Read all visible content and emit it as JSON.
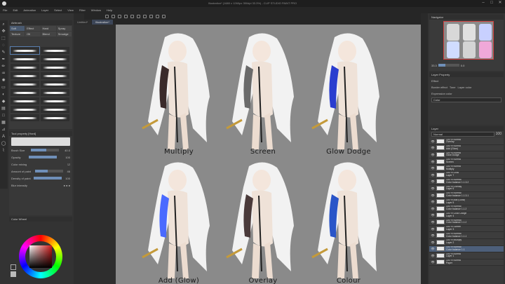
{
  "window": {
    "title": "Illustration* (1680 x 1260px 350dpi 33.3%) - CLIP STUDIO PAINT PRO",
    "controls": [
      "–",
      "□",
      "✕"
    ]
  },
  "menu": [
    "File",
    "Edit",
    "Animation",
    "Layer",
    "Select",
    "View",
    "Filter",
    "Window",
    "Help"
  ],
  "canvas_tabs": [
    "Untitled*",
    "Illustration*"
  ],
  "subtool": {
    "header": "Airbrush",
    "tabs": [
      "Soft",
      "Effect",
      "Hard",
      "Spray",
      "Texture",
      "Oil",
      "Blend",
      "Smudge"
    ]
  },
  "tool_property": {
    "header": "Tool property [Hard]",
    "brush_name": "Hard",
    "rows": [
      {
        "label": "Brush Size",
        "value": "40.0"
      },
      {
        "label": "Opacity",
        "value": "100"
      },
      {
        "label": "Color mixing",
        "value": ""
      },
      {
        "label": "Amount of paint",
        "value": "46"
      },
      {
        "label": "Density of paint",
        "value": "100"
      },
      {
        "label": "Blur intensity",
        "value": ""
      }
    ]
  },
  "color_panel": {
    "header": "Color Wheel"
  },
  "figures": [
    {
      "label": "Multiply",
      "accent": "#3a2a2a"
    },
    {
      "label": "Screen",
      "accent": "#6a6a6a"
    },
    {
      "label": "Glow Dodge",
      "accent": "#2a3dcf"
    },
    {
      "label": "Add (Glow)",
      "accent": "#4a6aff"
    },
    {
      "label": "Overlay",
      "accent": "#4a3a3a"
    },
    {
      "label": "Colour",
      "accent": "#2a55c8"
    }
  ],
  "navigator": {
    "header": "Navigator",
    "zoom": "33.3",
    "angle": "0.0"
  },
  "layer_property": {
    "header": "Layer Property",
    "effect_label": "Effect",
    "expression_label": "Expression color",
    "expression_value": "Color",
    "effect_buttons": [
      "Border effect",
      "Tone",
      "Layer color"
    ]
  },
  "layers": {
    "header": "Layer",
    "blend_mode": "Normal",
    "opacity": "100",
    "items": [
      {
        "name": "100 % Normal\nOverlay"
      },
      {
        "name": "100 % Normal\nAdd (Glow)"
      },
      {
        "name": "100 % Normal\nGlow Dodge"
      },
      {
        "name": "100 % Normal\nScreen"
      },
      {
        "name": "100 % Normal\nMultiply"
      },
      {
        "name": "100 % Glow\nLayer 7"
      },
      {
        "name": "100 % Normal\nColor balance 1.1.3.2"
      },
      {
        "name": "100 % Overlay\nLayer 6"
      },
      {
        "name": "100 % Normal\nColor balance 1.1.3.1"
      },
      {
        "name": "100 % Add (Glow)\nLayer 5"
      },
      {
        "name": "100 % Normal\nColor balance 1.1.3"
      },
      {
        "name": "100 % Glow Dodge\nLayer 4"
      },
      {
        "name": "100 % Normal\nColor balance 1.1.2"
      },
      {
        "name": "100 % Screen\nLayer 3"
      },
      {
        "name": "100 % Normal\nColor balance 1.1.1"
      },
      {
        "name": "100 % Multiply\nLayer 2"
      },
      {
        "name": "100 % Normal\nColor balance 1.1"
      },
      {
        "name": "100 % Normal\nLayer 1"
      },
      {
        "name": "100 % Normal\nPaper"
      }
    ],
    "selected_index": 16
  }
}
